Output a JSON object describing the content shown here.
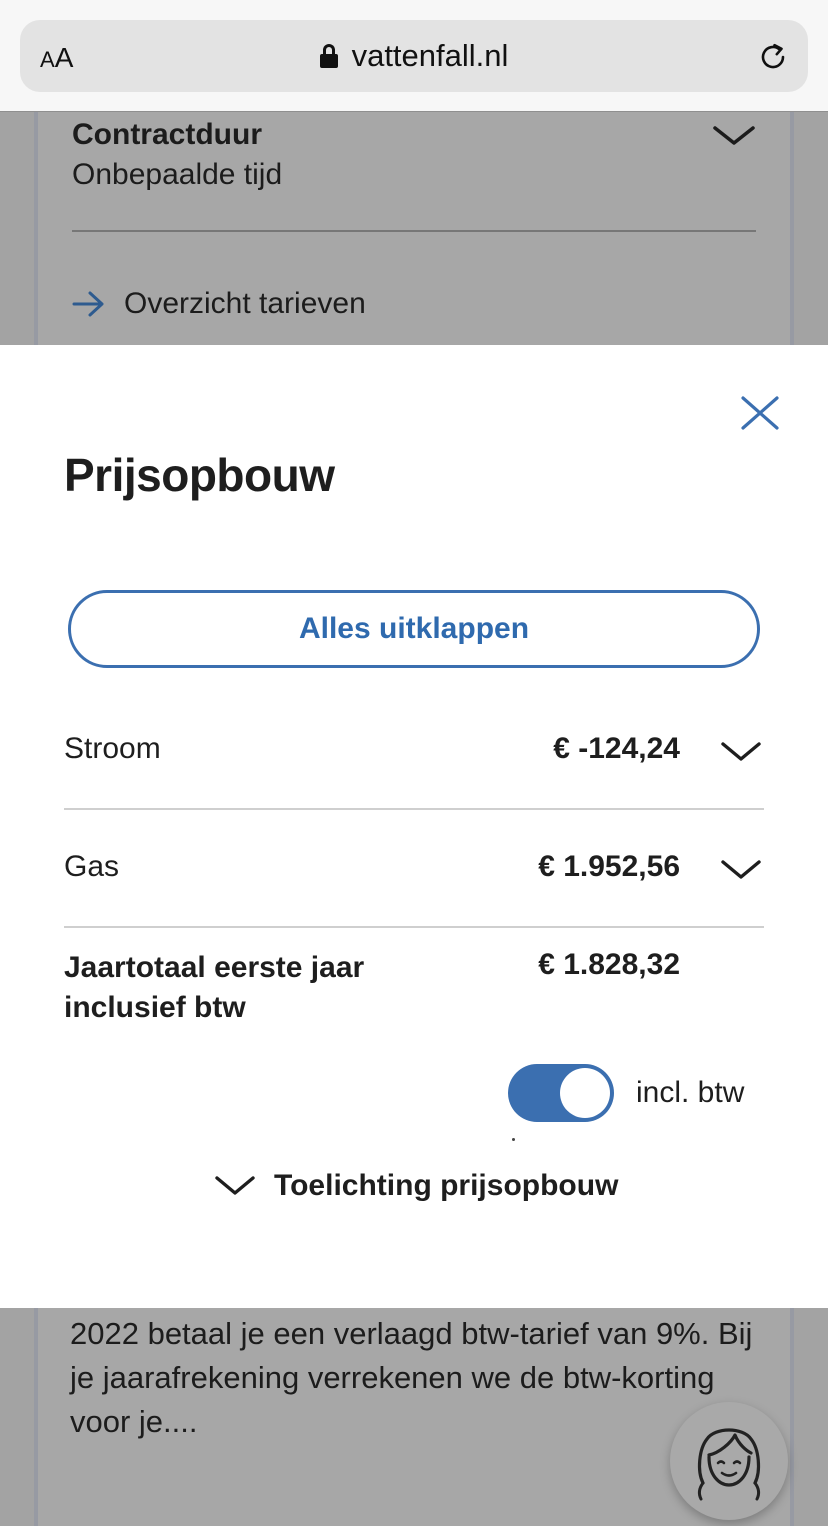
{
  "browser": {
    "aa_label_small": "A",
    "aa_label_large": "A",
    "url": "vattenfall.nl"
  },
  "background": {
    "contract_title": "Contractduur",
    "contract_value": "Onbepaalde tijd",
    "tarieven_link": "Overzicht tarieven",
    "paragraph": "2022 betaal je een verlaagd btw-tarief van 9%. Bij je jaarafrekening verrekenen we de btw-korting voor je...."
  },
  "modal": {
    "title": "Prijsopbouw",
    "expand_all_label": "Alles uitklappen",
    "rows": [
      {
        "label": "Stroom",
        "amount": "€ -124,24"
      },
      {
        "label": "Gas",
        "amount": "€ 1.952,56"
      }
    ],
    "total": {
      "label": "Jaartotaal eerste jaar inclusief btw",
      "amount": "€ 1.828,32"
    },
    "vat_toggle": {
      "label": "incl. btw",
      "on": true
    },
    "explanation_label": "Toelichting prijsopbouw"
  },
  "colors": {
    "accent": "#3b6fb0",
    "overlay_gray": "#a3a3a3"
  },
  "icons": [
    "lock-icon",
    "reload-icon",
    "chevron-down-icon",
    "arrow-right-icon",
    "close-icon",
    "chat-avatar-icon"
  ]
}
